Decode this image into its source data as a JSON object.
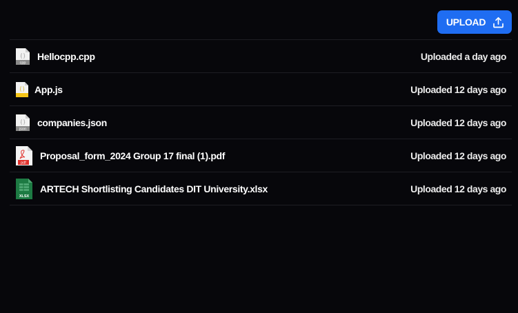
{
  "toolbar": {
    "upload_label": "UPLOAD"
  },
  "files": [
    {
      "name": "Hellocpp.cpp",
      "status": "Uploaded a day ago",
      "icon": "cpp-file-icon",
      "icon_label": "cpp",
      "icon_color": "#8a8a8a",
      "glyph": "{ }"
    },
    {
      "name": "App.js",
      "status": "Uploaded 12 days ago",
      "icon": "js-file-icon",
      "icon_label": "",
      "icon_color": "#f5c518",
      "glyph": "{ }"
    },
    {
      "name": "companies.json",
      "status": "Uploaded 12 days ago",
      "icon": "json-file-icon",
      "icon_label": "json",
      "icon_color": "#8a8a8a",
      "glyph": "{ }"
    },
    {
      "name": "Proposal_form_2024 Group 17 final (1).pdf",
      "status": "Uploaded 12 days ago",
      "icon": "pdf-file-icon",
      "icon_label": "pdf",
      "icon_color": "#e0312b",
      "glyph": "pdf"
    },
    {
      "name": "ARTECH Shortlisting Candidates DIT University.xlsx",
      "status": "Uploaded 12 days ago",
      "icon": "xlsx-file-icon",
      "icon_label": "XLSX",
      "icon_color": "#1d7a43",
      "glyph": "grid"
    }
  ]
}
